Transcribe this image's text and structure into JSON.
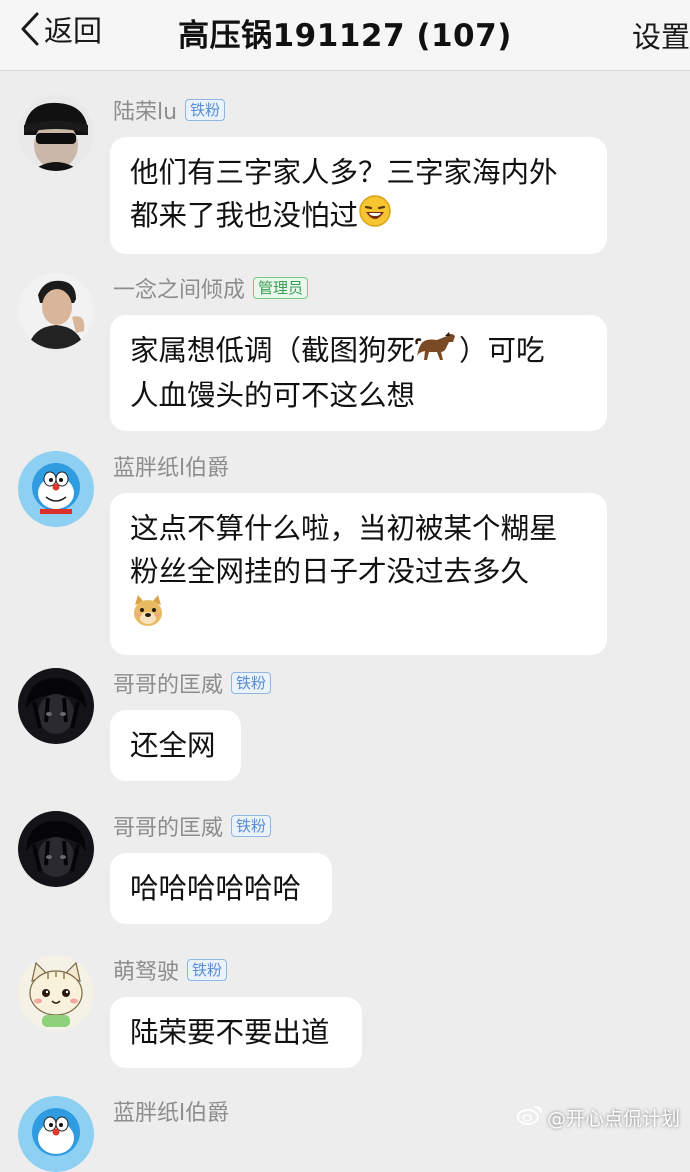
{
  "navbar": {
    "back_label": "返回",
    "title": "高压锅191127 (107)",
    "settings_label": "设置"
  },
  "messages": [
    {
      "sender": "陆荣lu",
      "badge": "铁粉",
      "badge_type": "fan",
      "avatar": "sunglasses-man-avatar",
      "lines": [
        "他们有三字家人多？三字家海内外",
        "都来了我也没怕过"
      ],
      "emoji": "laughing-face-emoji"
    },
    {
      "sender": "一念之间倾成",
      "badge": "管理员",
      "badge_type": "admin",
      "avatar": "man-portrait-avatar",
      "lines": [
        "家属想低调（截图狗死",
        "）可吃",
        "人血馒头的可不这么想"
      ],
      "emoji": "horse-emoji"
    },
    {
      "sender": "蓝胖纸l伯爵",
      "badge": "",
      "badge_type": "",
      "avatar": "doraemon-avatar",
      "lines": [
        "这点不算什么啦，当初被某个糊星",
        "粉丝全网挂的日子才没过去多久"
      ],
      "emoji": "doge-emoji"
    },
    {
      "sender": "哥哥的匡威",
      "badge": "铁粉",
      "badge_type": "fan",
      "avatar": "dark-anime-avatar",
      "lines": [
        "还全网"
      ]
    },
    {
      "sender": "哥哥的匡威",
      "badge": "铁粉",
      "badge_type": "fan",
      "avatar": "dark-anime-avatar",
      "lines": [
        "哈哈哈哈哈哈"
      ]
    },
    {
      "sender": "萌驽驶",
      "badge": "铁粉",
      "badge_type": "fan",
      "avatar": "cartoon-cat-avatar",
      "lines": [
        "陆荣要不要出道"
      ]
    },
    {
      "sender": "蓝胖纸l伯爵",
      "badge": "",
      "badge_type": "",
      "avatar": "doraemon-avatar"
    }
  ],
  "watermark": "@开心点侃计划"
}
